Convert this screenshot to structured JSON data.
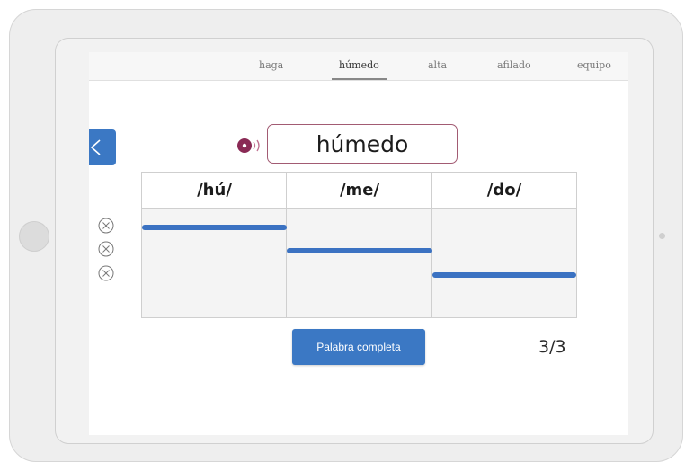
{
  "nav": {
    "words": [
      "haga",
      "húmedo",
      "alta",
      "afilado",
      "equipo"
    ],
    "active_index": 1
  },
  "prompt": {
    "word": "húmedo",
    "audio_icon": "speaker-icon"
  },
  "syllables": [
    {
      "label": "/hú/",
      "stress_level": "high"
    },
    {
      "label": "/me/",
      "stress_level": "medium"
    },
    {
      "label": "/do/",
      "stress_level": "low"
    }
  ],
  "attempts": {
    "icons": [
      "x-circle-icon",
      "x-circle-icon",
      "x-circle-icon"
    ]
  },
  "actions": {
    "complete_label": "Palabra completa"
  },
  "progress": {
    "counter": "3/3"
  },
  "colors": {
    "accent_blue": "#3b78c4",
    "bubble_border": "#a25b73",
    "speaker": "#8a2a55"
  }
}
